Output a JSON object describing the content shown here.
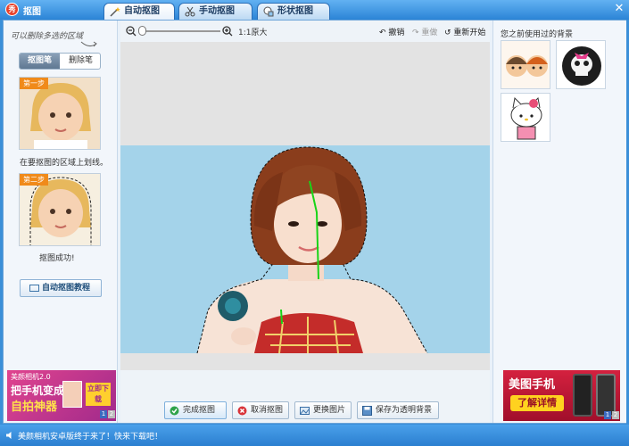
{
  "window": {
    "title": "抠图",
    "logo_text": "秀"
  },
  "tabs": [
    {
      "label": "自动抠图",
      "active": true
    },
    {
      "label": "手动抠图",
      "active": false
    },
    {
      "label": "形状抠图",
      "active": false
    }
  ],
  "close_label": "✕",
  "left_panel": {
    "hint": "可以删除多选的区域",
    "modes": {
      "active": "抠图笔",
      "inactive": "删除笔"
    },
    "step1": {
      "tag": "第一步",
      "caption": "在要抠图的区域上划线。"
    },
    "step2": {
      "tag": "第二步",
      "caption": "抠图成功!"
    },
    "tutorial_button": "自动抠图教程",
    "ad": {
      "title": "美颜相机2.0",
      "headline": "把手机变成",
      "subline": "自拍神器",
      "cta": "立即下载",
      "pages": [
        "1",
        "2"
      ]
    }
  },
  "toolbar": {
    "ratio": "1:1原大",
    "undo": "撤销",
    "redo": "重做",
    "restart": "重新开始"
  },
  "actions": {
    "finish": "完成抠图",
    "cancel": "取消抠图",
    "replace": "更换图片",
    "save": "保存为透明背景"
  },
  "right_panel": {
    "title": "您之前使用过的背景",
    "ad": {
      "title": "美图手机",
      "cta": "了解详情",
      "pages": [
        "1",
        "2"
      ]
    }
  },
  "status": {
    "text": "美颜相机安卓版终于来了！快来下载吧！"
  },
  "colors": {
    "accent": "#2b84d6",
    "photo_bg": "#a4d3ea",
    "stroke": "#18d418"
  }
}
